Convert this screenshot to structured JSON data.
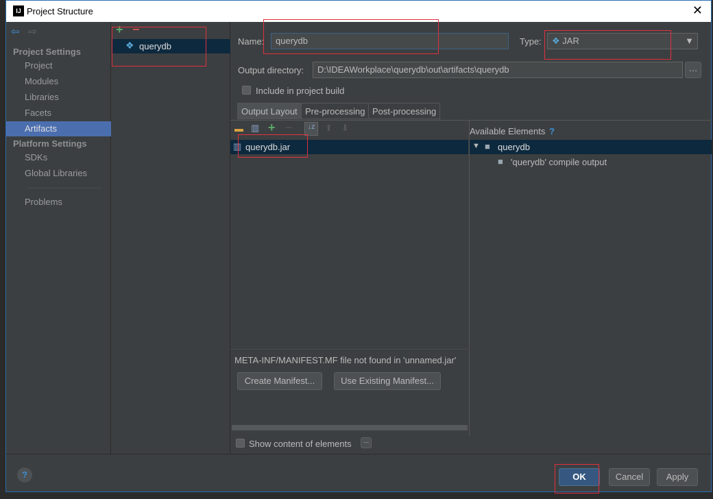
{
  "window": {
    "title": "Project Structure",
    "logo": "IJ"
  },
  "sidebar": {
    "project_settings": "Project Settings",
    "platform_settings": "Platform Settings",
    "items": [
      "Project",
      "Modules",
      "Libraries",
      "Facets",
      "Artifacts"
    ],
    "platform_items": [
      "SDKs",
      "Global Libraries"
    ],
    "problems": "Problems",
    "selected": "Artifacts"
  },
  "artifacts": {
    "items": [
      "querydb"
    ]
  },
  "form": {
    "name_label": "Name:",
    "name_value": "querydb",
    "type_label": "Type:",
    "type_value": "JAR",
    "output_label": "Output directory:",
    "output_value": "D:\\IDEAWorkplace\\querydb\\out\\artifacts\\querydb",
    "include_label": "Include in project build",
    "include_checked": false
  },
  "tabs": [
    "Output Layout",
    "Pre-processing",
    "Post-processing"
  ],
  "layout": {
    "root": "querydb.jar",
    "available_label": "Available Elements",
    "available_help": "?",
    "tree": [
      {
        "label": "querydb",
        "expanded": true
      },
      {
        "label": "'querydb' compile output"
      }
    ],
    "manifest_msg": "META-INF/MANIFEST.MF file not found in 'unnamed.jar'",
    "create_manifest": "Create Manifest...",
    "use_manifest": "Use Existing Manifest...",
    "show_content": "Show content of elements",
    "more": "..."
  },
  "footer": {
    "ok": "OK",
    "cancel": "Cancel",
    "apply": "Apply",
    "help": "?"
  },
  "colors": {
    "accent": "#4b6eaf",
    "annotation": "#e0303f",
    "add": "#59a869",
    "remove": "#c75450"
  }
}
